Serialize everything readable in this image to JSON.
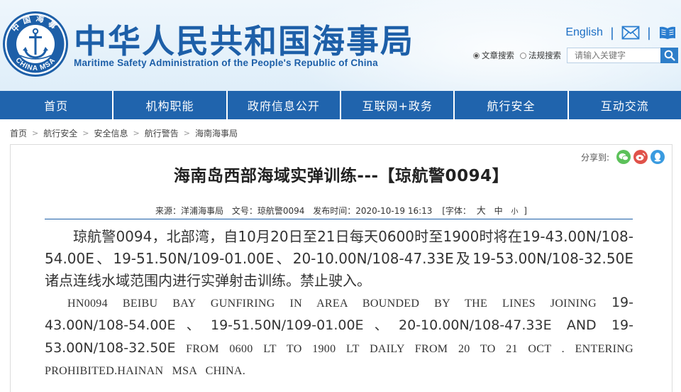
{
  "header": {
    "logo": {
      "top_text": "中国海事",
      "bottom_text": "CHINA MSA",
      "icon": "anchor-emblem-icon"
    },
    "title_cn": "中华人民共和国海事局",
    "title_en": "Maritime Safety Administration of the People's Republic of China",
    "english_link": "English",
    "separator": "|",
    "mail_icon": "mail-icon",
    "book_icon": "book-icon",
    "search": {
      "radio_articles": "文章搜索",
      "radio_laws": "法规搜索",
      "placeholder": "请输入关键字",
      "search_icon": "search-icon"
    }
  },
  "nav": {
    "items": [
      {
        "label": "首页"
      },
      {
        "label": "机构职能"
      },
      {
        "label": "政府信息公开"
      },
      {
        "label": "互联网+政务"
      },
      {
        "label": "航行安全"
      },
      {
        "label": "互动交流"
      }
    ]
  },
  "breadcrumb": {
    "items": [
      "首页",
      "航行安全",
      "安全信息",
      "航行警告",
      "海南海事局"
    ],
    "separator": ">"
  },
  "article": {
    "share_label": "分享到:",
    "share_icons": [
      "wechat-icon",
      "weibo-icon",
      "qq-icon"
    ],
    "title": "海南岛西部海域实弹训练---【琼航警0094】",
    "meta": {
      "source": "来源：洋浦海事局",
      "doc_no": "文号：琼航警0094",
      "publish_time": "发布时间：2020-10-19 16:13",
      "font_label_open": "[字体：",
      "font_big": "大",
      "font_mid": "中",
      "font_small": "小",
      "font_label_close": "]"
    },
    "paragraph_cn": "琼航警0094，北部湾，自10月20日至21日每天0600时至1900时将在19-43.00N/108-54.00E、19-51.50N/109-01.00E、20-10.00N/108-47.33E及19-53.00N/108-32.50E诸点连线水域范围内进行实弹射击训练。禁止驶入。",
    "paragraph_en_1": "HN0094 BEIBU BAY GUNFIRING IN AREA BOUNDED BY THE LINES JOINING ",
    "paragraph_en_2": "19-43.00N/108-54.00E、19-51.50N/109-01.00E、20-10.00N/108-47.33E AND 19-53.00N/108-32.50E",
    "paragraph_en_3": " FROM 0600 LT  TO 1900 LT DAILY FROM 20 TO 21 OCT . ENTERING PROHIBITED.HAINAN MSA CHINA."
  },
  "colors": {
    "brand_blue": "#1d5fa8",
    "nav_blue": "#2064ad",
    "search_blue": "#2e7ec9",
    "wechat_green": "#5cc15a",
    "weibo_red": "#e0524a",
    "qq_blue": "#3a9be0"
  }
}
